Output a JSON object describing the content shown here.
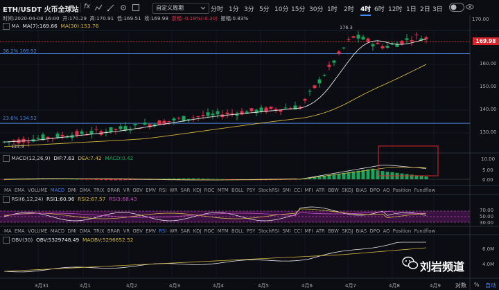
{
  "header": {
    "symbol": "ETH/USDT 火币全球站",
    "caret": "▾",
    "fx": "fx",
    "custom_period": "自定义周期",
    "periods": [
      "分时",
      "1分",
      "3分",
      "5分",
      "10分",
      "15分",
      "30分",
      "1时",
      "2时",
      "4时",
      "6时",
      "12时",
      "1日",
      "2日",
      "3日"
    ],
    "active_period": "4时",
    "eye_icon": "eye-icon",
    "toggle_icon": "eye-toggle-icon"
  },
  "info": {
    "time": "时间:2020-04-08 16:00",
    "open": "开:170.29",
    "high": "高:170.91",
    "low": "低:169.51",
    "close": "收:169.98",
    "change": "涨幅:-0.18%(-0.30)",
    "amplitude": "振幅:0.83%"
  },
  "main": {
    "legend_name": "MA",
    "ma7": "MA(7):169.66",
    "ma30": "MA(30):153.76",
    "high_mark": "176.3",
    "low_mark": "123.9",
    "last_price": "169.98",
    "fib_upper": "38.2% 169.92",
    "fib_lower": "23.6% 134.52",
    "yticks": [
      "170.00",
      "160.00",
      "150.00",
      "140.00",
      "130.00"
    ]
  },
  "macd": {
    "name": "MACD(12,26,9)",
    "dif": "DIF:7.63",
    "dea": "DEA:7.42",
    "macd": "MACD:0.42",
    "yticks": [
      "10.00",
      "5.00",
      "0.00"
    ]
  },
  "rsi": {
    "name": "RSI(6,12,24)",
    "rsi1": "RSI1:60.96",
    "rsi2": "RSI2:67.57",
    "rsi3": "RSI3:68.43",
    "yticks": [
      "70.00",
      "50.00",
      "30.00"
    ]
  },
  "obv": {
    "name": "OBV(30)",
    "obv": "OBV:5329748.49",
    "maobv": "MAOBV:5296652.52",
    "yticks": [
      "6.0M",
      "4.0M"
    ]
  },
  "indicator_tabs": [
    "MA",
    "EMA",
    "VOLUME",
    "MACD",
    "DMI",
    "DMA",
    "TRIX",
    "BRAR",
    "VR",
    "OBV",
    "EMV",
    "RSI",
    "WR",
    "SAR",
    "KDJ",
    "ROC",
    "MTM",
    "BOLL",
    "PSY",
    "StochRSI",
    "SMI",
    "CCI",
    "MFI",
    "ATR",
    "BBW",
    "SKDJ",
    "BIAS",
    "DPO",
    "AO",
    "Position",
    "Fundflow"
  ],
  "tab_rows": [
    {
      "active": "MACD"
    },
    {
      "active": "RSI"
    }
  ],
  "dates": [
    "3月31",
    "4月1",
    "4月2",
    "4月3",
    "4月4",
    "4月5",
    "4月6",
    "4月7",
    "4月8",
    "4月9"
  ],
  "bottom_buttons": {
    "pct": "%",
    "log": "对数",
    "auto": "自动"
  },
  "watermark": "刘岩频道",
  "colors": {
    "up": "#1aa35a",
    "down": "#e0304a",
    "ma7": "#e8e8e8",
    "ma30": "#d4b640",
    "fib": "#4a7fd6",
    "accent": "#3d7cf0",
    "annotation": "#d9262c"
  }
}
